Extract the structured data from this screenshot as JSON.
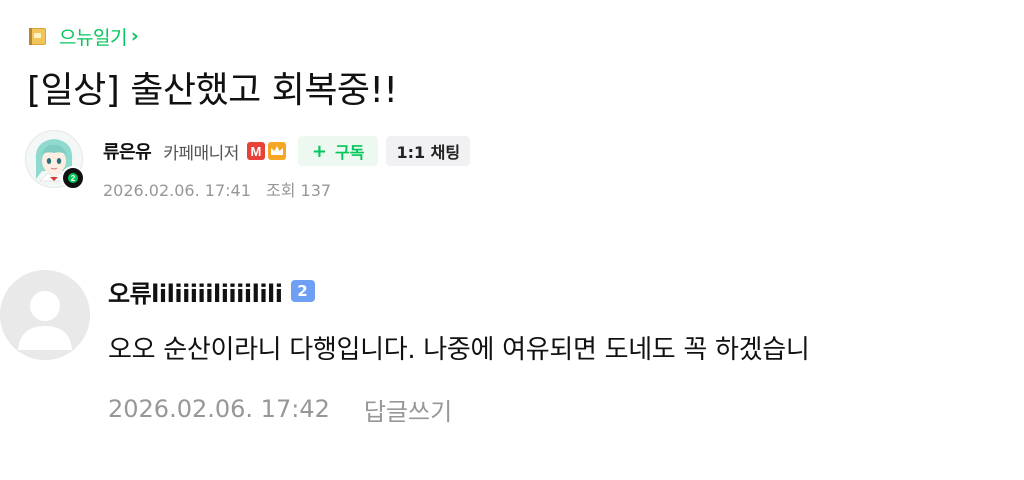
{
  "board": {
    "icon": "folder-book-icon",
    "label": "으뉴일기",
    "chevron": "›",
    "color": "#03c75a"
  },
  "post": {
    "title": "[일상] 출산했고 회복중!!",
    "author": {
      "name": "류은유",
      "role": "카페매니저",
      "role_badge_text": "M",
      "level_badge_text": "2"
    },
    "subscribe_plus": "+",
    "subscribe_label": "구독",
    "chat_label": "1:1 채팅",
    "date": "2026.02.06. 17:41",
    "views": "조회 137"
  },
  "comment": {
    "author": "오류liliiiiiliiiilili",
    "level_badge": "2",
    "text": "오오 순산이라니 다행입니다. 나중에 여유되면 도네도 꼭 하겠습니",
    "date": "2026.02.06. 17:42",
    "reply_label": "답글쓰기"
  },
  "colors": {
    "accent": "#03c75a",
    "meta": "#979797",
    "manager_badge": "#e8413a",
    "crown_badge": "#f5a623",
    "comment_level_badge": "#6e9ff5"
  }
}
